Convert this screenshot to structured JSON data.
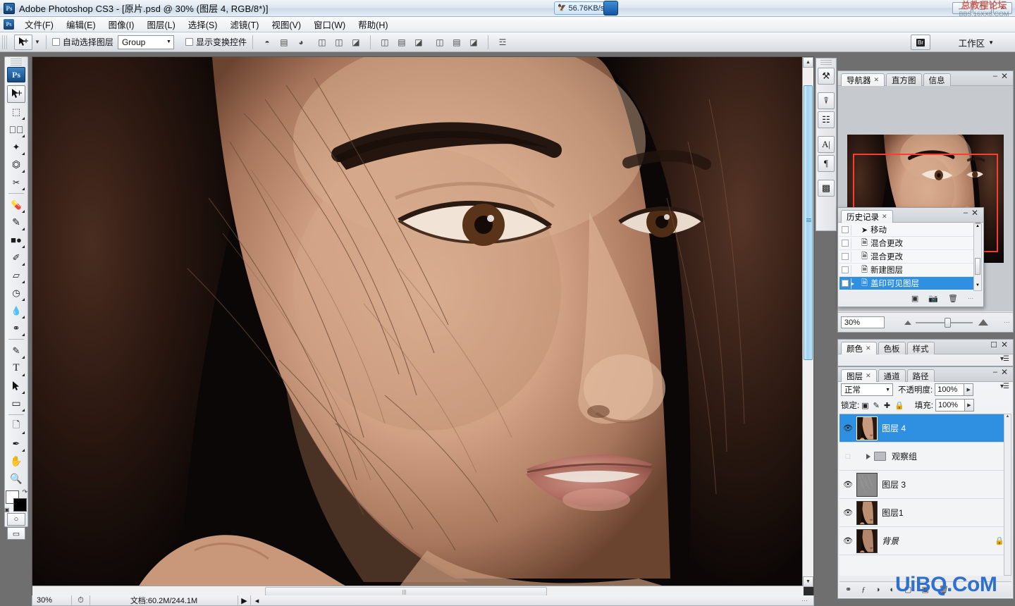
{
  "app": {
    "title": "Adobe Photoshop CS3 - [原片.psd @ 30% (图层 4, RGB/8*)]",
    "logo": "Ps"
  },
  "titlebar": {
    "net_speed": "56.76KB/s",
    "net_icon": "bird-icon",
    "flash_icon": "lightning-icon",
    "minimize": "—",
    "restore": "❐",
    "close": "✕",
    "watermark_line1": "总教程论坛",
    "watermark_line2": "BBS.16XX8.COM"
  },
  "menubar": {
    "items": [
      {
        "label": "文件(F)",
        "name": "menu-file"
      },
      {
        "label": "编辑(E)",
        "name": "menu-edit"
      },
      {
        "label": "图像(I)",
        "name": "menu-image"
      },
      {
        "label": "图层(L)",
        "name": "menu-layer"
      },
      {
        "label": "选择(S)",
        "name": "menu-select"
      },
      {
        "label": "滤镜(T)",
        "name": "menu-filter"
      },
      {
        "label": "视图(V)",
        "name": "menu-view"
      },
      {
        "label": "窗口(W)",
        "name": "menu-window"
      },
      {
        "label": "帮助(H)",
        "name": "menu-help"
      }
    ]
  },
  "optionsbar": {
    "tool_icon": "move-tool-icon",
    "auto_select_label": "自动选择图层",
    "auto_select_checked": false,
    "group_value": "Group",
    "show_transform_label": "显示变换控件",
    "show_transform_checked": false,
    "align_icons": [
      "align-top-edges-icon",
      "align-vertical-centers-icon",
      "align-bottom-edges-icon",
      "align-left-edges-icon",
      "align-horizontal-centers-icon",
      "align-right-edges-icon"
    ],
    "distribute_icons": [
      "distribute-top-icon",
      "distribute-vcenter-icon",
      "distribute-bottom-icon",
      "distribute-left-icon",
      "distribute-hcenter-icon",
      "distribute-right-icon"
    ],
    "link_icon": "auto-align-layers-icon",
    "bridge_label": "Br",
    "workspace_label": "工作区"
  },
  "toolbar": {
    "badge": "Ps",
    "tools": [
      {
        "name": "move-tool",
        "glyph": "➤",
        "selected": true,
        "sub": false
      },
      {
        "name": "marquee-tool",
        "glyph": "⬚",
        "selected": false,
        "sub": true
      },
      {
        "name": "lasso-tool",
        "glyph": "❀",
        "selected": false,
        "sub": true
      },
      {
        "name": "quick-selection-tool",
        "glyph": "✒",
        "selected": false,
        "sub": true
      },
      {
        "name": "crop-tool",
        "glyph": "⌗",
        "selected": false,
        "sub": true
      },
      {
        "name": "slice-tool",
        "glyph": "✂",
        "selected": false,
        "sub": true
      },
      {
        "name": "healing-brush-tool",
        "glyph": "⚕",
        "selected": false,
        "sub": true
      },
      {
        "name": "brush-tool",
        "glyph": "✎",
        "selected": false,
        "sub": true
      },
      {
        "name": "clone-stamp-tool",
        "glyph": "⚑",
        "selected": false,
        "sub": true
      },
      {
        "name": "history-brush-tool",
        "glyph": "✐",
        "selected": false,
        "sub": true
      },
      {
        "name": "eraser-tool",
        "glyph": "▱",
        "selected": false,
        "sub": true
      },
      {
        "name": "gradient-tool",
        "glyph": "◧",
        "selected": false,
        "sub": true
      },
      {
        "name": "blur-tool",
        "glyph": "●",
        "selected": false,
        "sub": true
      },
      {
        "name": "dodge-tool",
        "glyph": "⚲",
        "selected": false,
        "sub": true
      },
      {
        "name": "pen-tool",
        "glyph": "✑",
        "selected": false,
        "sub": true
      },
      {
        "name": "type-tool",
        "glyph": "T",
        "selected": false,
        "sub": true
      },
      {
        "name": "path-selection-tool",
        "glyph": "➤",
        "selected": false,
        "sub": true
      },
      {
        "name": "rectangle-tool",
        "glyph": "▭",
        "selected": false,
        "sub": true
      },
      {
        "name": "notes-tool",
        "glyph": "▤",
        "selected": false,
        "sub": true
      },
      {
        "name": "eyedropper-tool",
        "glyph": "✒",
        "selected": false,
        "sub": true
      },
      {
        "name": "hand-tool",
        "glyph": "✋",
        "selected": false,
        "sub": false
      },
      {
        "name": "zoom-tool",
        "glyph": "⚲",
        "selected": false,
        "sub": false
      }
    ],
    "foreground_color": "#ffffff",
    "background_color": "#000000",
    "swap_icon": "swap-colors-icon",
    "default_icon": "default-colors-icon",
    "quickmask_icon": "quick-mask-icon",
    "screenmode_icon": "screen-mode-icon"
  },
  "statusbar": {
    "zoom": "30%",
    "clock_icon": "clock-icon",
    "doc_info": "文档:60.2M/244.1M",
    "play_icon": "▶",
    "left_arrow": "◂",
    "grip": "⋯"
  },
  "icondock": {
    "items": [
      {
        "name": "tool-presets-icon",
        "glyph": "⚒"
      },
      {
        "name": "brushes-icon",
        "glyph": "☱"
      },
      {
        "name": "clone-source-icon",
        "glyph": "✇"
      },
      {
        "name": "character-icon",
        "glyph": "A"
      },
      {
        "name": "paragraph-icon",
        "glyph": "¶"
      },
      {
        "name": "layer-comps-icon",
        "glyph": "▥"
      }
    ]
  },
  "navigator": {
    "tabs": [
      {
        "label": "导航器",
        "active": true,
        "closable": true
      },
      {
        "label": "直方图",
        "active": false,
        "closable": false
      },
      {
        "label": "信息",
        "active": false,
        "closable": false
      }
    ],
    "zoom_value": "30%",
    "view_box_color": "#ff3b30",
    "zoom_out_icon": "zoom-out-icon",
    "zoom_in_icon": "zoom-in-icon",
    "menu_icon": "panel-menu-icon"
  },
  "history": {
    "tab_label": "历史记录",
    "entries": [
      {
        "label": "移动",
        "icon": "move-state-icon",
        "selected": false,
        "snapshot": false
      },
      {
        "label": "混合更改",
        "icon": "blend-state-icon",
        "selected": false,
        "snapshot": false
      },
      {
        "label": "混合更改",
        "icon": "blend-state-icon",
        "selected": false,
        "snapshot": false
      },
      {
        "label": "新建图层",
        "icon": "newlayer-state-icon",
        "selected": false,
        "snapshot": false
      },
      {
        "label": "盖印可见图层",
        "icon": "stamp-state-icon",
        "selected": true,
        "snapshot": false
      }
    ],
    "footer_icons": [
      {
        "name": "new-document-from-state-icon",
        "glyph": "▣"
      },
      {
        "name": "new-snapshot-icon",
        "glyph": "☗"
      },
      {
        "name": "delete-state-icon",
        "glyph": "♻"
      }
    ]
  },
  "color_panel": {
    "tabs": [
      {
        "label": "颜色",
        "active": true,
        "closable": true
      },
      {
        "label": "色板",
        "active": false,
        "closable": false
      },
      {
        "label": "样式",
        "active": false,
        "closable": false
      }
    ]
  },
  "layers": {
    "tabs": [
      {
        "label": "图层",
        "active": true,
        "closable": true
      },
      {
        "label": "通道",
        "active": false,
        "closable": false
      },
      {
        "label": "路径",
        "active": false,
        "closable": false
      }
    ],
    "blend_mode": "正常",
    "opacity_label": "不透明度:",
    "opacity_value": "100%",
    "lock_label": "锁定:",
    "lock_icons": [
      {
        "name": "lock-transparency-icon",
        "glyph": "▨"
      },
      {
        "name": "lock-image-icon",
        "glyph": "✎"
      },
      {
        "name": "lock-position-icon",
        "glyph": "✚"
      },
      {
        "name": "lock-all-icon",
        "glyph": "🔒"
      }
    ],
    "fill_label": "填充:",
    "fill_value": "100%",
    "rows": [
      {
        "name": "图层 4",
        "visible": true,
        "selected": true,
        "type": "layer",
        "thumb": "portrait",
        "locked": false
      },
      {
        "name": "观察组",
        "visible": false,
        "selected": false,
        "type": "group",
        "thumb": "folder",
        "locked": false
      },
      {
        "name": "图层 3",
        "visible": true,
        "selected": false,
        "type": "layer",
        "thumb": "gray",
        "locked": false
      },
      {
        "name": "图层1",
        "visible": true,
        "selected": false,
        "type": "layer",
        "thumb": "portrait",
        "locked": false
      },
      {
        "name": "背景",
        "visible": true,
        "selected": false,
        "type": "layer",
        "thumb": "portrait",
        "locked": true
      }
    ],
    "footer_icons": [
      {
        "name": "link-layers-icon",
        "glyph": "⚭"
      },
      {
        "name": "layer-style-icon",
        "glyph": "ƒ"
      },
      {
        "name": "layer-mask-icon",
        "glyph": "◑"
      },
      {
        "name": "adjustment-layer-icon",
        "glyph": "◔"
      },
      {
        "name": "new-group-icon",
        "glyph": "▢"
      },
      {
        "name": "new-layer-icon",
        "glyph": "▤"
      },
      {
        "name": "delete-layer-icon",
        "glyph": "♻"
      }
    ]
  },
  "watermark_bottom": "UiBQ.CoM"
}
